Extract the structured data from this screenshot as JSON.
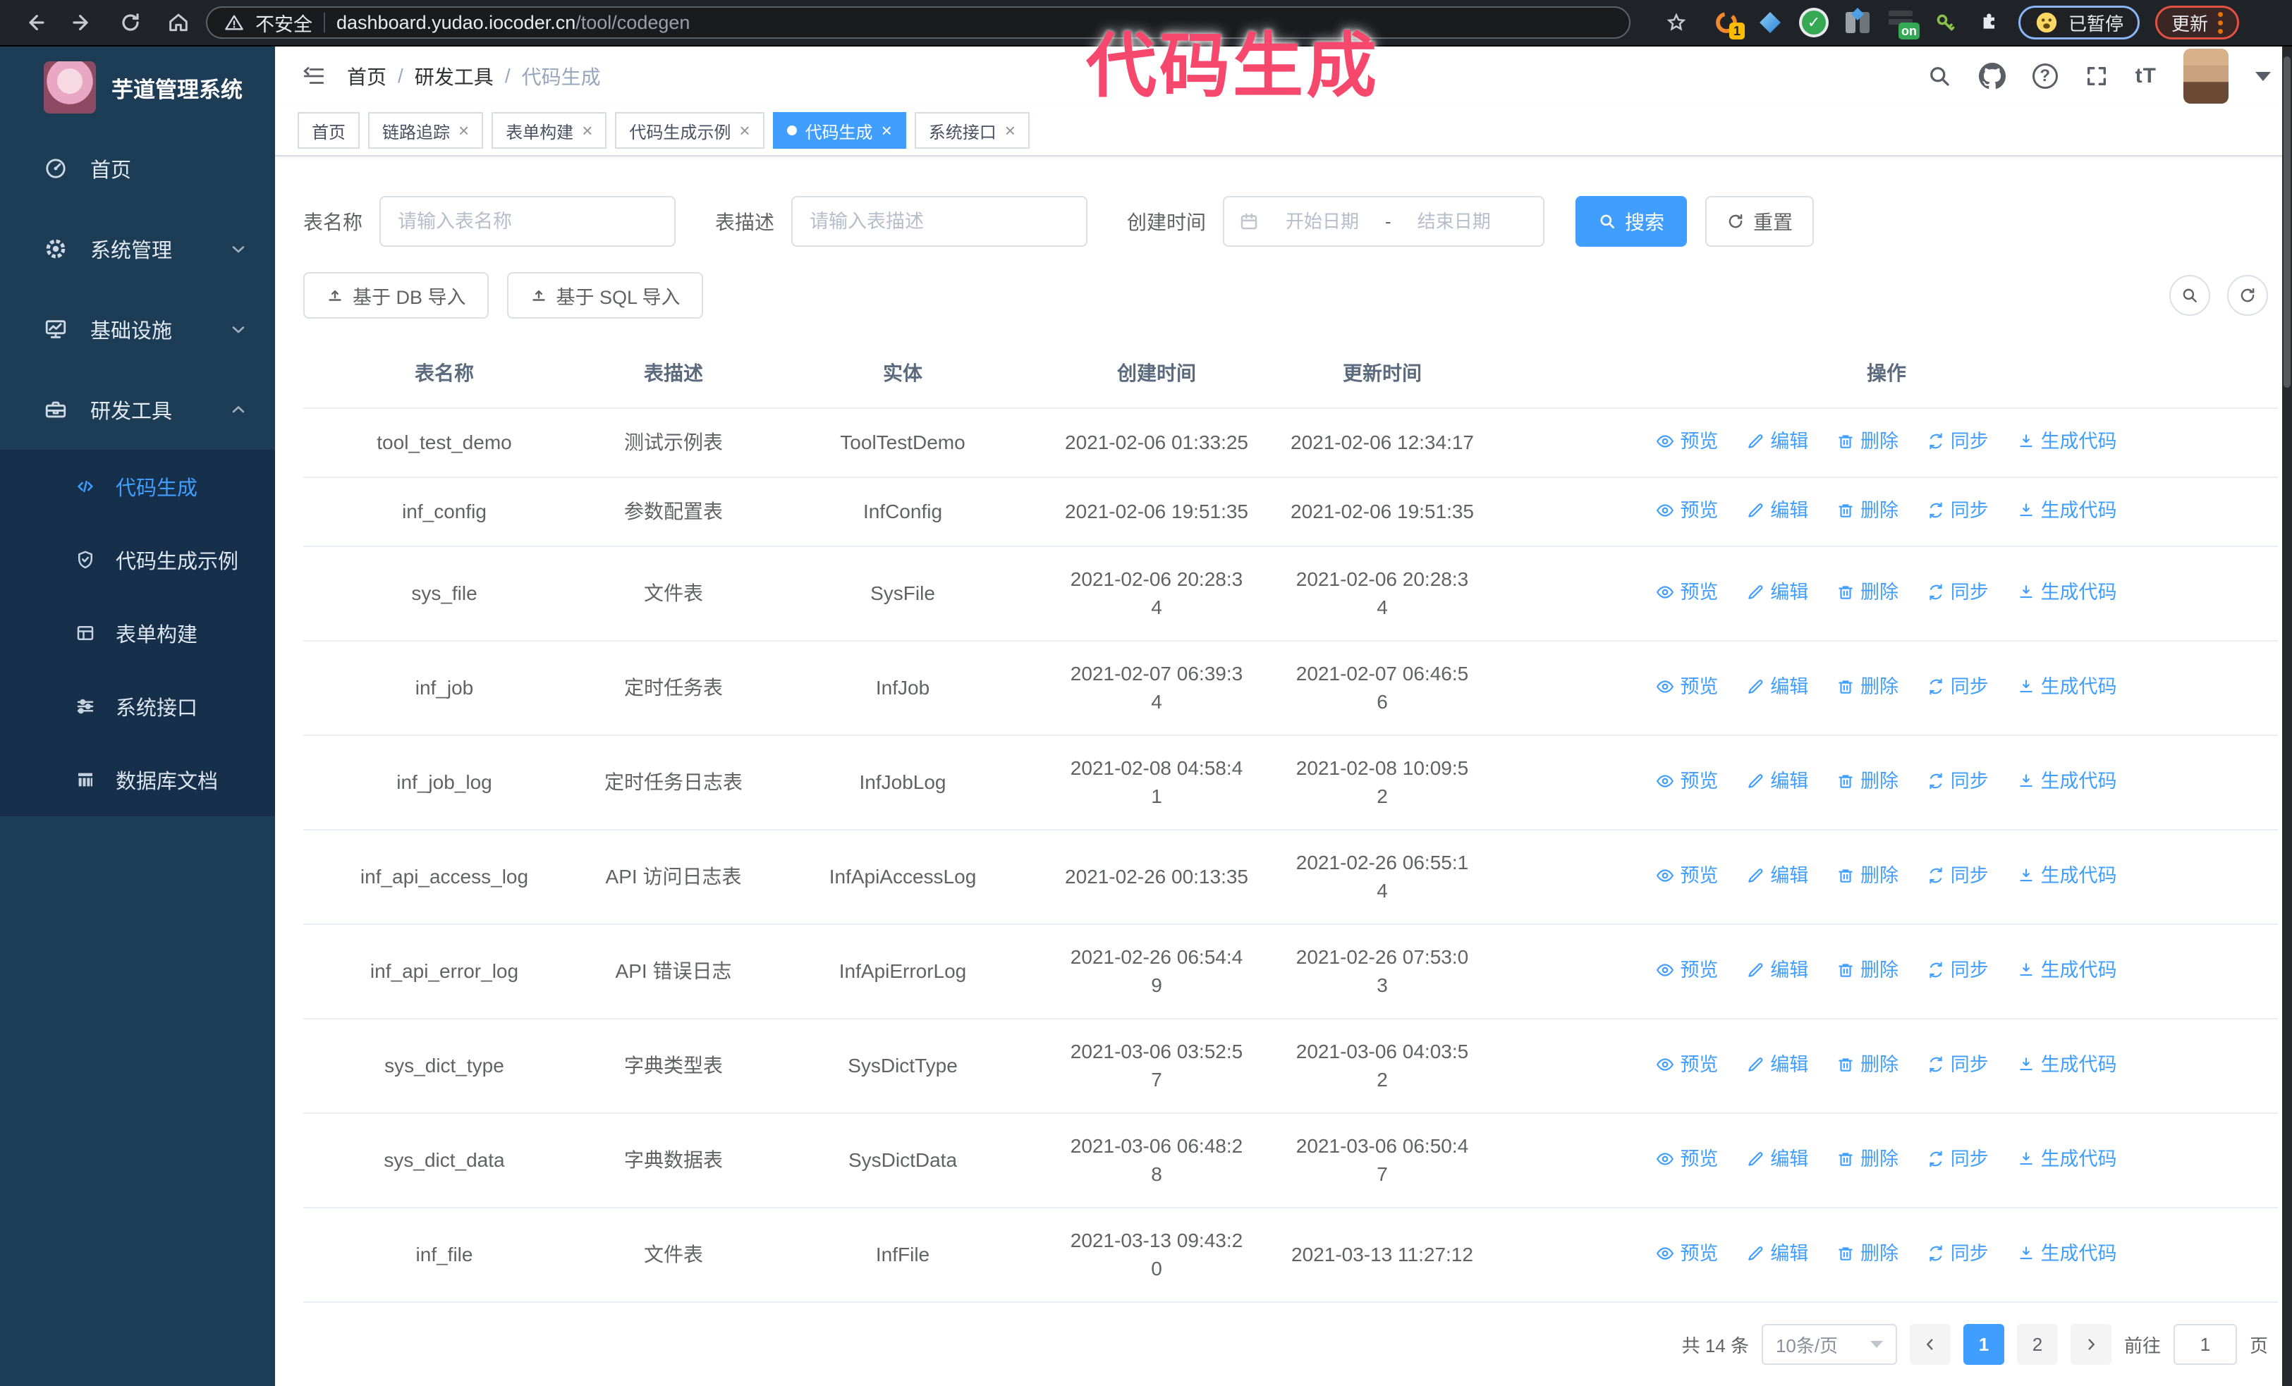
{
  "colors": {
    "primary": "#409EFF",
    "overlay_pink": "#f5486c",
    "sidebar_bg": "#1d3c56",
    "submenu_bg": "#16304b"
  },
  "browser": {
    "security_label": "不安全",
    "url_domain": "dashboard.yudao.iocoder.cn",
    "url_path": "/tool/codegen",
    "ext_badge_count": "1",
    "ext_badge_on": "on",
    "paused_badge": "已暂停",
    "update_badge": "更新"
  },
  "overlay": {
    "title": "代码生成"
  },
  "icons": {
    "close": "×",
    "check": "✓",
    "help": "?",
    "font_size": "tT"
  },
  "sidebar": {
    "app_title": "芋道管理系统",
    "menu": [
      {
        "label": "首页"
      },
      {
        "label": "系统管理"
      },
      {
        "label": "基础设施"
      },
      {
        "label": "研发工具"
      }
    ],
    "submenu": [
      {
        "label": "代码生成"
      },
      {
        "label": "代码生成示例"
      },
      {
        "label": "表单构建"
      },
      {
        "label": "系统接口"
      },
      {
        "label": "数据库文档"
      }
    ]
  },
  "header": {
    "breadcrumb": [
      "首页",
      "研发工具",
      "代码生成"
    ],
    "breadcrumb_separator": "/"
  },
  "tabs": [
    {
      "label": "首页"
    },
    {
      "label": "链路追踪"
    },
    {
      "label": "表单构建"
    },
    {
      "label": "代码生成示例"
    },
    {
      "label": "代码生成"
    },
    {
      "label": "系统接口"
    }
  ],
  "filters": {
    "name_label": "表名称",
    "name_placeholder": "请输入表名称",
    "desc_label": "表描述",
    "desc_placeholder": "请输入表描述",
    "time_label": "创建时间",
    "start_placeholder": "开始日期",
    "range_separator": "-",
    "end_placeholder": "结束日期",
    "search_label": "搜索",
    "reset_label": "重置"
  },
  "toolbar": {
    "import_db_label": "基于 DB 导入",
    "import_sql_label": "基于 SQL 导入"
  },
  "table": {
    "columns": [
      "表名称",
      "表描述",
      "实体",
      "创建时间",
      "更新时间",
      "操作"
    ],
    "actions": [
      "预览",
      "编辑",
      "删除",
      "同步",
      "生成代码"
    ],
    "rows": [
      {
        "name": "tool_test_demo",
        "desc": "测试示例表",
        "entity": "ToolTestDemo",
        "created": "2021-02-06 01:33:25",
        "updated": "2021-02-06 12:34:17"
      },
      {
        "name": "inf_config",
        "desc": "参数配置表",
        "entity": "InfConfig",
        "created": "2021-02-06 19:51:35",
        "updated": "2021-02-06 19:51:35"
      },
      {
        "name": "sys_file",
        "desc": "文件表",
        "entity": "SysFile",
        "created": "2021-02-06 20:28:3\n4",
        "updated": "2021-02-06 20:28:3\n4"
      },
      {
        "name": "inf_job",
        "desc": "定时任务表",
        "entity": "InfJob",
        "created": "2021-02-07 06:39:3\n4",
        "updated": "2021-02-07 06:46:5\n6"
      },
      {
        "name": "inf_job_log",
        "desc": "定时任务日志表",
        "entity": "InfJobLog",
        "created": "2021-02-08 04:58:4\n1",
        "updated": "2021-02-08 10:09:5\n2"
      },
      {
        "name": "inf_api_access_log",
        "desc": "API 访问日志表",
        "entity": "InfApiAccessLog",
        "created": "2021-02-26 00:13:35",
        "updated": "2021-02-26 06:55:1\n4"
      },
      {
        "name": "inf_api_error_log",
        "desc": "API 错误日志",
        "entity": "InfApiErrorLog",
        "created": "2021-02-26 06:54:4\n9",
        "updated": "2021-02-26 07:53:0\n3"
      },
      {
        "name": "sys_dict_type",
        "desc": "字典类型表",
        "entity": "SysDictType",
        "created": "2021-03-06 03:52:5\n7",
        "updated": "2021-03-06 04:03:5\n2"
      },
      {
        "name": "sys_dict_data",
        "desc": "字典数据表",
        "entity": "SysDictData",
        "created": "2021-03-06 06:48:2\n8",
        "updated": "2021-03-06 06:50:4\n7"
      },
      {
        "name": "inf_file",
        "desc": "文件表",
        "entity": "InfFile",
        "created": "2021-03-13 09:43:2\n0",
        "updated": "2021-03-13 11:27:12"
      }
    ]
  },
  "pagination": {
    "total_text": "共 14 条",
    "page_size": "10条/页",
    "pages": [
      "1",
      "2"
    ],
    "goto_label": "前往",
    "goto_value": "1",
    "page_suffix": "页"
  }
}
